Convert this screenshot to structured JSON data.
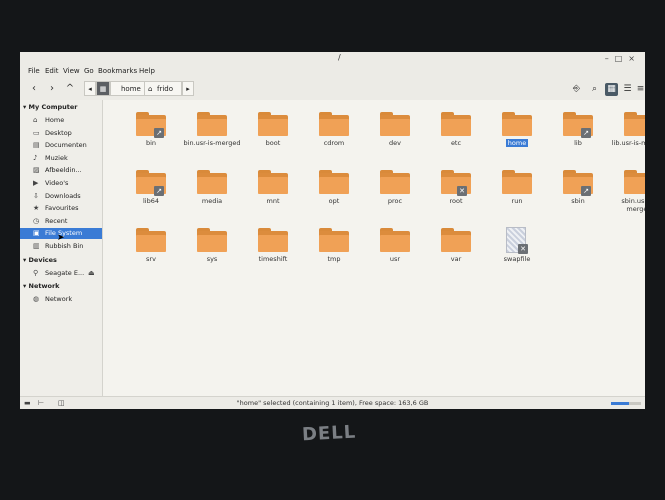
{
  "window": {
    "title": "/",
    "controls": [
      "–",
      "□",
      "×"
    ]
  },
  "logo": "DELL",
  "menu": [
    "File",
    "Edit",
    "View",
    "Go",
    "Bookmarks",
    "Help"
  ],
  "toolbar": {
    "back": "‹",
    "forward": "›",
    "up": "^",
    "breadcrumbs": [
      "home",
      "frido"
    ]
  },
  "sidebar": {
    "sections": [
      {
        "title": "My Computer",
        "items": [
          {
            "label": "Home",
            "icon": "home-icon"
          },
          {
            "label": "Desktop",
            "icon": "desktop-icon"
          },
          {
            "label": "Documenten",
            "icon": "documents-icon"
          },
          {
            "label": "Muziek",
            "icon": "music-icon"
          },
          {
            "label": "Afbeeldin...",
            "icon": "pictures-icon"
          },
          {
            "label": "Video's",
            "icon": "videos-icon"
          },
          {
            "label": "Downloads",
            "icon": "downloads-icon"
          },
          {
            "label": "Favourites",
            "icon": "star-icon"
          },
          {
            "label": "Recent",
            "icon": "clock-icon"
          },
          {
            "label": "File System",
            "icon": "drive-icon"
          },
          {
            "label": "Rubbish Bin",
            "icon": "trash-icon"
          }
        ]
      },
      {
        "title": "Devices",
        "items": [
          {
            "label": "Seagate E...",
            "icon": "usb-icon"
          }
        ]
      },
      {
        "title": "Network",
        "items": [
          {
            "label": "Network",
            "icon": "network-icon"
          }
        ]
      }
    ]
  },
  "files": [
    {
      "name": "bin",
      "type": "folder",
      "badge": "link"
    },
    {
      "name": "bin.usr-is-merged",
      "type": "folder",
      "badge": ""
    },
    {
      "name": "boot",
      "type": "folder",
      "badge": ""
    },
    {
      "name": "cdrom",
      "type": "folder",
      "badge": ""
    },
    {
      "name": "dev",
      "type": "folder",
      "badge": ""
    },
    {
      "name": "etc",
      "type": "folder",
      "badge": ""
    },
    {
      "name": "home",
      "type": "folder",
      "badge": "",
      "selected": true
    },
    {
      "name": "lib",
      "type": "folder",
      "badge": "link"
    },
    {
      "name": "lib.usr-is-merged",
      "type": "folder",
      "badge": ""
    },
    {
      "name": "lib64",
      "type": "folder",
      "badge": "link"
    },
    {
      "name": "media",
      "type": "folder",
      "badge": ""
    },
    {
      "name": "mnt",
      "type": "folder",
      "badge": ""
    },
    {
      "name": "opt",
      "type": "folder",
      "badge": ""
    },
    {
      "name": "proc",
      "type": "folder",
      "badge": ""
    },
    {
      "name": "root",
      "type": "folder",
      "badge": "locked"
    },
    {
      "name": "run",
      "type": "folder",
      "badge": ""
    },
    {
      "name": "sbin",
      "type": "folder",
      "badge": "link"
    },
    {
      "name": "sbin.usr-is-merged",
      "type": "folder",
      "badge": ""
    },
    {
      "name": "srv",
      "type": "folder",
      "badge": ""
    },
    {
      "name": "sys",
      "type": "folder",
      "badge": ""
    },
    {
      "name": "timeshift",
      "type": "folder",
      "badge": ""
    },
    {
      "name": "tmp",
      "type": "folder",
      "badge": ""
    },
    {
      "name": "usr",
      "type": "folder",
      "badge": ""
    },
    {
      "name": "var",
      "type": "folder",
      "badge": ""
    },
    {
      "name": "swapfile",
      "type": "file",
      "badge": "locked"
    }
  ],
  "status": "\"home\" selected (containing 1 item), Free space: 163,6 GB",
  "zoom_level": 0.6,
  "colors": {
    "folder": "#f0a156",
    "accent": "#3a7bd5"
  }
}
